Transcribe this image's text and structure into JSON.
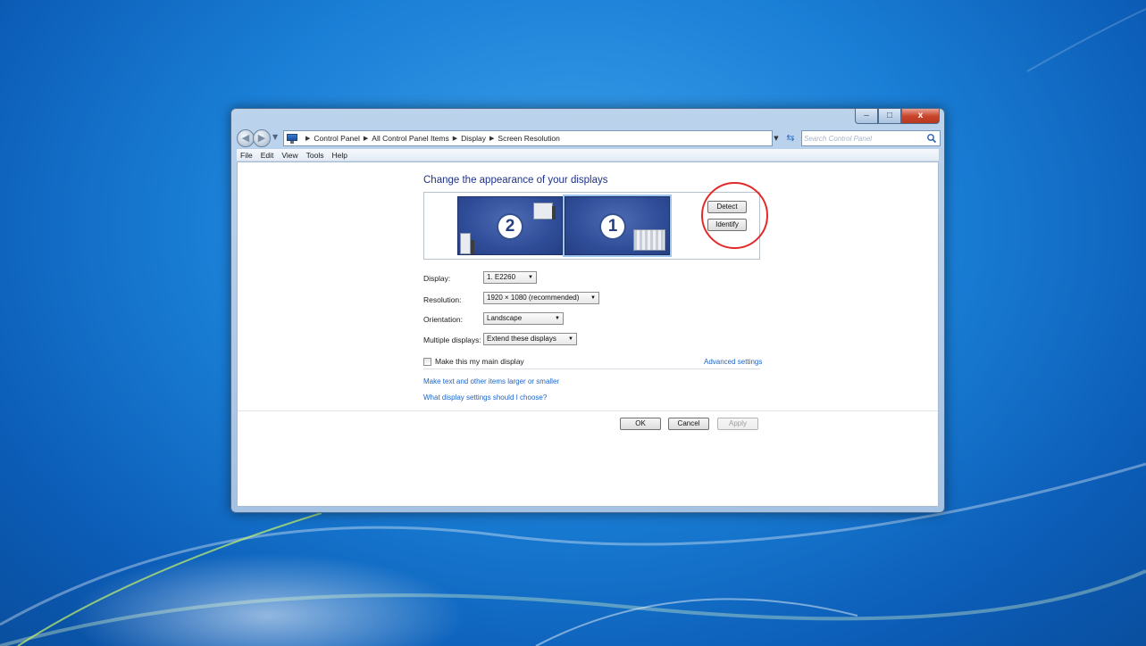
{
  "window": {
    "caption_buttons": {
      "minimize": "–",
      "maximize": "□",
      "close": "x"
    },
    "colors": {
      "close": "#c9462c",
      "link": "#1c64c8",
      "title": "#1e3287",
      "highlight_circle": "#e32a2a"
    }
  },
  "nav": {
    "back_icon": "back-arrow-icon",
    "forward_icon": "forward-arrow-icon",
    "breadcrumb": [
      "Control Panel",
      "All Control Panel Items",
      "Display",
      "Screen Resolution"
    ],
    "search_placeholder": "Search Control Panel"
  },
  "menu": [
    "File",
    "Edit",
    "View",
    "Tools",
    "Help"
  ],
  "page": {
    "title": "Change the appearance of your displays",
    "monitors": [
      {
        "number": "2"
      },
      {
        "number": "1"
      }
    ],
    "detect_label": "Detect",
    "identify_label": "Identify",
    "display_label": "Display:",
    "display_value": "1. E2260",
    "resolution_label": "Resolution:",
    "resolution_value": "1920 × 1080 (recommended)",
    "orientation_label": "Orientation:",
    "orientation_value": "Landscape",
    "multiple_label": "Multiple displays:",
    "multiple_value": "Extend these displays",
    "main_display_label": "Make this my main display",
    "advanced_link": "Advanced settings",
    "link_text_size": "Make text and other items larger or smaller",
    "link_which_settings": "What display settings should I choose?"
  },
  "footer": {
    "ok": "OK",
    "cancel": "Cancel",
    "apply": "Apply"
  }
}
